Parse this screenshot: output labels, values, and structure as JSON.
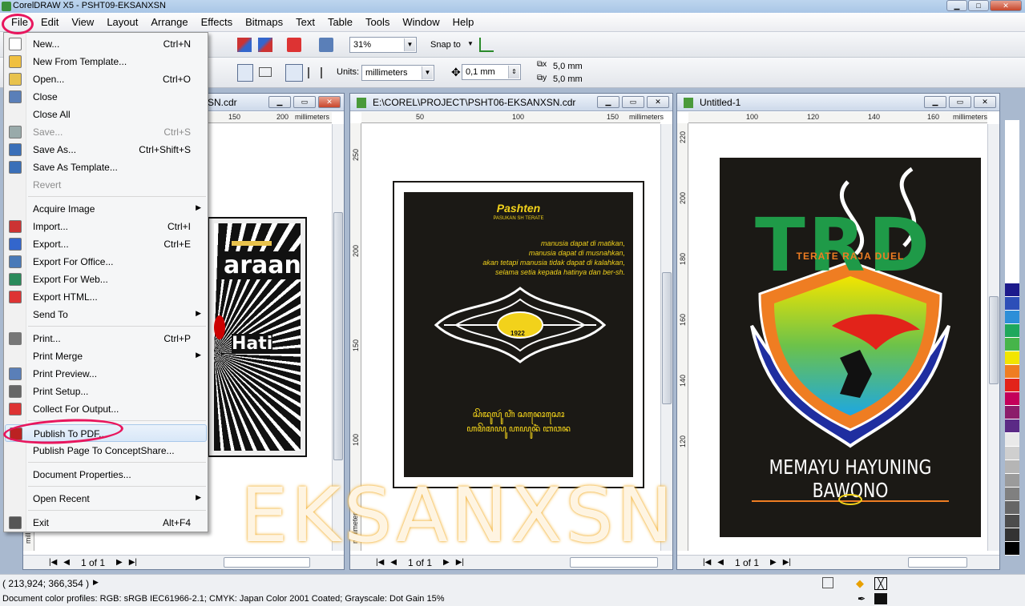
{
  "window": {
    "title": "CorelDRAW X5 - PSHT09-EKSANXSN"
  },
  "menubar": [
    "File",
    "Edit",
    "View",
    "Layout",
    "Arrange",
    "Effects",
    "Bitmaps",
    "Text",
    "Table",
    "Tools",
    "Window",
    "Help"
  ],
  "toolbar": {
    "zoom": "31%",
    "snap_to": "Snap to",
    "units_label": "Units:",
    "units_value": "millimeters",
    "nudge": "0,1 mm",
    "dup_x": "5,0 mm",
    "dup_y": "5,0 mm"
  },
  "file_menu": [
    {
      "label": "New...",
      "shortcut": "Ctrl+N",
      "icon": "new-document-icon"
    },
    {
      "label": "New From Template...",
      "shortcut": "",
      "icon": "template-icon"
    },
    {
      "label": "Open...",
      "shortcut": "Ctrl+O",
      "icon": "folder-open-icon"
    },
    {
      "label": "Close",
      "shortcut": "",
      "icon": "close-document-icon"
    },
    {
      "label": "Close All",
      "shortcut": "",
      "icon": ""
    },
    {
      "label": "Save...",
      "shortcut": "Ctrl+S",
      "icon": "save-icon",
      "disabled": true
    },
    {
      "label": "Save As...",
      "shortcut": "Ctrl+Shift+S",
      "icon": "save-as-icon"
    },
    {
      "label": "Save As Template...",
      "shortcut": "",
      "icon": "save-template-icon"
    },
    {
      "label": "Revert",
      "shortcut": "",
      "icon": "",
      "disabled": true
    },
    {
      "label": "Acquire Image",
      "shortcut": "",
      "submenu": true
    },
    {
      "label": "Import...",
      "shortcut": "Ctrl+I",
      "icon": "import-icon"
    },
    {
      "label": "Export...",
      "shortcut": "Ctrl+E",
      "icon": "export-icon"
    },
    {
      "label": "Export For Office...",
      "shortcut": "",
      "icon": "export-office-icon"
    },
    {
      "label": "Export For Web...",
      "shortcut": "",
      "icon": "export-web-icon"
    },
    {
      "label": "Export HTML...",
      "shortcut": "",
      "icon": "export-html-icon"
    },
    {
      "label": "Send To",
      "shortcut": "",
      "submenu": true
    },
    {
      "label": "Print...",
      "shortcut": "Ctrl+P",
      "icon": "print-icon"
    },
    {
      "label": "Print Merge",
      "shortcut": "",
      "submenu": true
    },
    {
      "label": "Print Preview...",
      "shortcut": "",
      "icon": "print-preview-icon"
    },
    {
      "label": "Print Setup...",
      "shortcut": "",
      "icon": "print-setup-icon"
    },
    {
      "label": "Collect For Output...",
      "shortcut": "",
      "icon": "collect-output-icon"
    },
    {
      "label": "Publish To PDF...",
      "shortcut": "",
      "icon": "pdf-icon"
    },
    {
      "label": "Publish Page To ConceptShare...",
      "shortcut": ""
    },
    {
      "label": "Document Properties...",
      "shortcut": ""
    },
    {
      "label": "Open Recent",
      "shortcut": "",
      "submenu": true
    },
    {
      "label": "Exit",
      "shortcut": "Alt+F4",
      "icon": "exit-icon"
    }
  ],
  "doc1": {
    "title": "SN.cdr",
    "ruler_h": [
      "150",
      "200",
      "millimeters"
    ],
    "page": "1 of 1",
    "artwork_text": [
      "araan",
      "Hati"
    ]
  },
  "doc2": {
    "title": "E:\\COREL\\PROJECT\\PSHT06-EKSANXSN.cdr",
    "ruler_h": [
      "50",
      "100",
      "150",
      "millimeters"
    ],
    "ruler_v": [
      "250",
      "200",
      "150",
      "100"
    ],
    "page": "1 of 1",
    "art": {
      "heading": "Pashten",
      "sub": "PASUKAN SH TERATE",
      "lines": [
        "manusia dapat di matikan,",
        "manusia dapat di musnahkan,",
        "akan tetapi manusia tidak dapat di kalahkan,",
        "selama setia kepada hatinya dan ber-sh."
      ],
      "emblem": "1922",
      "footer1": "ꦱꦼꦢꦸꦭꦸꦂ ꦲꦶꦁ ꦱꦤꦺꦴꦱꦺꦴ",
      "footer2": "ꦲꦩꦼꦩꦪꦸ ꦲꦪꦸꦤꦶꦁ ꦧꦮꦤ"
    }
  },
  "doc3": {
    "title": "Untitled-1",
    "ruler_h": [
      "100",
      "120",
      "140",
      "160",
      "millimeters"
    ],
    "ruler_v": [
      "220",
      "200",
      "180",
      "160",
      "140",
      "120"
    ],
    "page": "1 of 1",
    "art": {
      "big": "TRD",
      "sub": "TERATE RAJA DUEL",
      "bottom": "MEMAYU HAYUNING BAWONO"
    }
  },
  "ruler_unit_v": "millimeters",
  "watermark": "EKSANXSN",
  "status": {
    "coords": "( 213,924; 366,354 )",
    "profiles": "Document color profiles: RGB: sRGB IEC61966-2.1; CMYK: Japan Color 2001 Coated; Grayscale: Dot Gain 15%"
  },
  "palette": [
    "#ffffff",
    "#ffffff",
    "#ffffff",
    "#ffffff",
    "#ffffff",
    "#ffffff",
    "#ffffff",
    "#ffffff",
    "#ffffff",
    "#ffffff",
    "#ffffff",
    "#ffffff",
    "#1c1a8c",
    "#2d4fb8",
    "#2c8fd8",
    "#1fa85c",
    "#46b54a",
    "#f2e500",
    "#ef7d22",
    "#e2231a",
    "#c4005a",
    "#8c1d6b",
    "#5b2a86",
    "#e9e9e9",
    "#cfcfcf",
    "#b5b5b5",
    "#9b9b9b",
    "#808080",
    "#666666",
    "#4c4c4c",
    "#333333",
    "#000000"
  ]
}
